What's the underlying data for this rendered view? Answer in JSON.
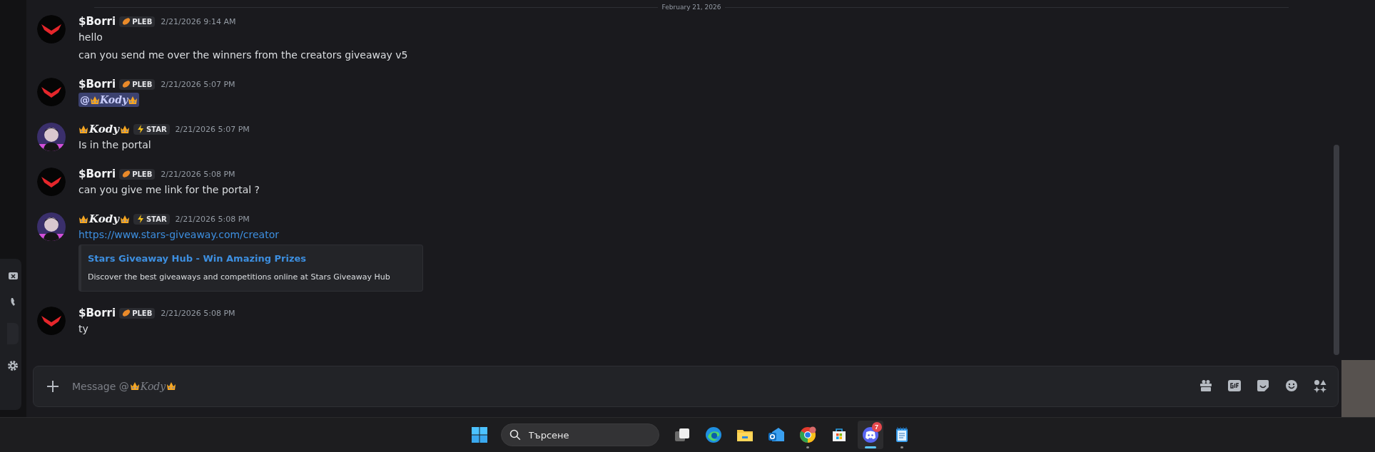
{
  "divider": {
    "date": "February 21, 2026"
  },
  "messages": [
    {
      "kind": "plain",
      "author": "$Borri",
      "badge": {
        "label": "PLEB"
      },
      "timestamp": "2/21/2026 9:14 AM",
      "lines": [
        {
          "kind": "text",
          "text": "hello"
        },
        {
          "kind": "text",
          "text": "can you send me over the winners from the creators giveaway v5"
        }
      ]
    },
    {
      "kind": "plain",
      "author": "$Borri",
      "badge": {
        "label": "PLEB"
      },
      "timestamp": "2/21/2026 5:07 PM",
      "lines": [
        {
          "kind": "mention",
          "at": "@",
          "name": "Kody"
        }
      ]
    },
    {
      "kind": "crowned",
      "author": "Kody",
      "badge": {
        "label": "STAR"
      },
      "timestamp": "2/21/2026 5:07 PM",
      "lines": [
        {
          "kind": "text",
          "text": "Is in the portal"
        }
      ]
    },
    {
      "kind": "plain",
      "author": "$Borri",
      "badge": {
        "label": "PLEB"
      },
      "timestamp": "2/21/2026 5:08 PM",
      "lines": [
        {
          "kind": "text",
          "text": "can you give me link for the portal ?"
        }
      ]
    },
    {
      "kind": "crowned",
      "author": "Kody",
      "badge": {
        "label": "STAR"
      },
      "timestamp": "2/21/2026 5:08 PM",
      "lines": [
        {
          "kind": "link",
          "text": "https://www.stars-giveaway.com/creator"
        },
        {
          "kind": "embed",
          "title": "Stars Giveaway Hub - Win Amazing Prizes",
          "description": "Discover the best giveaways and competitions online at Stars Giveaway Hub"
        }
      ]
    },
    {
      "kind": "plain",
      "author": "$Borri",
      "badge": {
        "label": "PLEB"
      },
      "timestamp": "2/21/2026 5:08 PM",
      "lines": [
        {
          "kind": "text",
          "text": "ty"
        }
      ]
    }
  ],
  "composer": {
    "placeholder": "Message @",
    "recipient": "Kody"
  },
  "taskbar": {
    "search": {
      "placeholder": "Търсене"
    },
    "apps": [
      {
        "kind": "taskview",
        "running": false,
        "active": false
      },
      {
        "kind": "edge",
        "running": false,
        "active": false
      },
      {
        "kind": "explorer",
        "running": false,
        "active": false
      },
      {
        "kind": "outlook",
        "running": false,
        "active": false
      },
      {
        "kind": "chrome",
        "running": true,
        "active": false
      },
      {
        "kind": "store",
        "running": false,
        "active": false
      },
      {
        "kind": "discord",
        "running": true,
        "active": true,
        "badge": "7"
      },
      {
        "kind": "notepad",
        "running": true,
        "active": false
      }
    ]
  }
}
